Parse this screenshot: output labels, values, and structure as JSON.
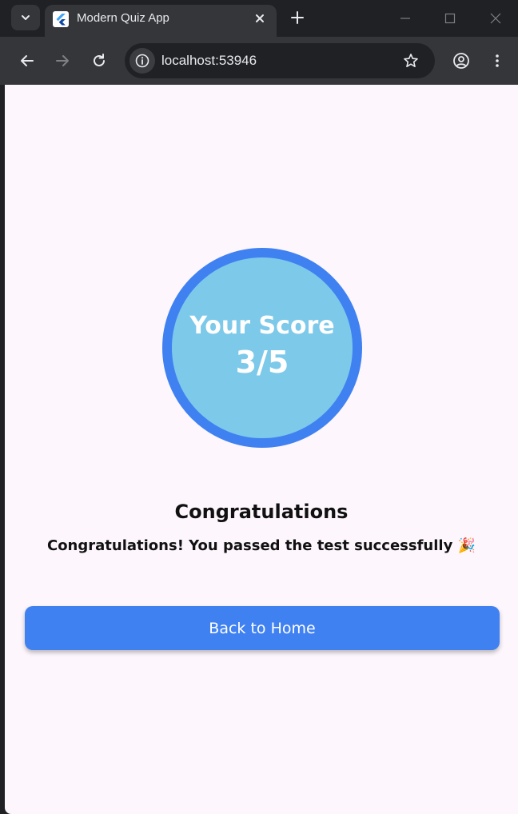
{
  "browser": {
    "tab_title": "Modern Quiz App",
    "url": "localhost:53946",
    "icons": {
      "tab_search": "chevron-down-icon",
      "favicon": "flutter-icon",
      "tab_close": "close-icon",
      "new_tab": "plus-icon",
      "minimize": "minimize-icon",
      "maximize": "maximize-icon",
      "close_window": "close-icon",
      "back": "arrow-left-icon",
      "forward": "arrow-right-icon",
      "reload": "reload-icon",
      "site_info": "info-icon",
      "bookmark": "star-icon",
      "profile": "profile-icon",
      "menu": "kebab-menu-icon"
    }
  },
  "result": {
    "score_label": "Your Score",
    "score_value": "3/5",
    "title": "Congratulations",
    "message": "Congratulations! You passed the test successfully 🎉",
    "button_label": "Back to Home"
  },
  "colors": {
    "accent": "#4081f2",
    "circle_fill": "#7dc9e9",
    "page_background": "#fdf7fd",
    "chrome_dark": "#202124",
    "chrome_toolbar": "#35363a"
  }
}
